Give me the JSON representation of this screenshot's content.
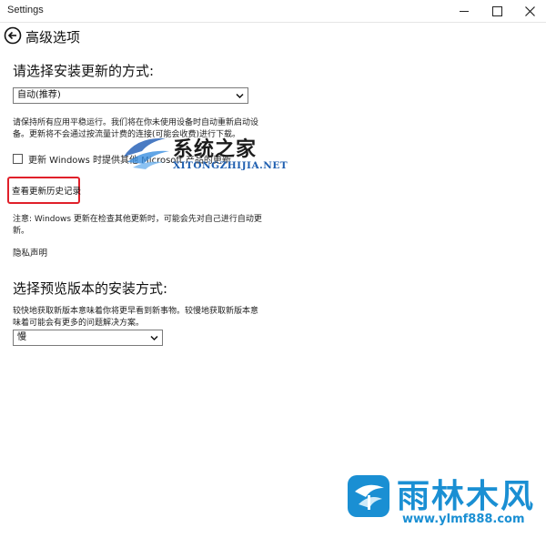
{
  "window": {
    "title": "Settings",
    "controls": [
      "minimize-icon",
      "maximize-icon",
      "close-icon"
    ]
  },
  "header": {
    "back_icon": "back-arrow-icon",
    "title": "高级选项"
  },
  "install_section": {
    "heading": "请选择安装更新的方式:",
    "dropdown_value": "自动(推荐)",
    "description_lines": [
      "请保持所有应用平稳运行。我们将在你未使用设备时自动重新启动设",
      "备。更新将不会通过按流量计费的连接(可能会收费)进行下载。"
    ],
    "checkbox_label": "更新 Windows 时提供其他 Microsoft 产品的更新",
    "checkbox_checked": false,
    "history_link": "查看更新历史记录",
    "note_lines": [
      "注意: Windows 更新在检查其他更新时，可能会先对自己进行自动更",
      "新。"
    ],
    "privacy_link": "隐私声明"
  },
  "preview_section": {
    "heading": "选择预览版本的安装方式:",
    "description_lines": [
      "较快地获取新版本意味着你将更早看到新事物。较慢地获取新版本意",
      "味着可能会有更多的问题解决方案。"
    ],
    "dropdown_value": "慢"
  },
  "watermarks": {
    "top": {
      "cn": "系统之家",
      "en": "XITONGZHIJIA.NET"
    },
    "bottom": {
      "cn": "雨林木风",
      "url": "www.ylmf888.com"
    }
  },
  "colors": {
    "highlight_border": "#e0202a",
    "watermark_blue": "#1a8fd3"
  }
}
